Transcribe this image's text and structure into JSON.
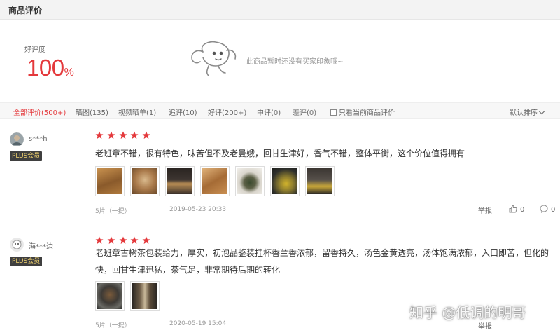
{
  "header": {
    "title": "商品评价"
  },
  "summary": {
    "rate_label": "好评度",
    "rate_number": "100",
    "rate_suffix": "%",
    "empty_impression": "此商品暂时还没有买家印象哦~"
  },
  "filters": {
    "items": [
      {
        "label": "全部评价(500+)",
        "active": true
      },
      {
        "label": "晒图(135)"
      },
      {
        "label": "视频晒单(1)"
      },
      {
        "label": "追评(10)"
      },
      {
        "label": "好评(200+)"
      },
      {
        "label": "中评(0)"
      },
      {
        "label": "差评(0)"
      }
    ],
    "only_current_label": "只看当前商品评价",
    "sort_label": "默认排序"
  },
  "reviews": [
    {
      "user": "s***h",
      "badge": "PLUS会员",
      "rating": 5,
      "content": "老班章不错，很有特色，味苦但不及老曼娥，回甘生津好，香气不错，整体平衡，这个价位值得拥有",
      "photo_count": 7,
      "spec": "5片（一提）",
      "date": "2019-05-23 20:33",
      "report_label": "举报",
      "likes": "0",
      "comments": "0"
    },
    {
      "user": "海***边",
      "badge": "PLUS会员",
      "rating": 5,
      "content": "老班章古树茶包装给力，厚实，初泡品鉴装挂杯香兰香浓郁，留香持久，汤色金黄透亮，汤体饱满浓郁，入口即苦，但化的快，回甘生津迅猛，茶气足，非常期待后期的转化",
      "photo_count": 2,
      "spec": "5片（一提）",
      "date": "2020-05-19 15:04",
      "report_label": "举报"
    }
  ],
  "watermark": "知乎 @低调的明哥",
  "colors": {
    "accent": "#e4393c",
    "badge_bg": "#3f3f3f",
    "badge_text": "#f4d56f"
  }
}
